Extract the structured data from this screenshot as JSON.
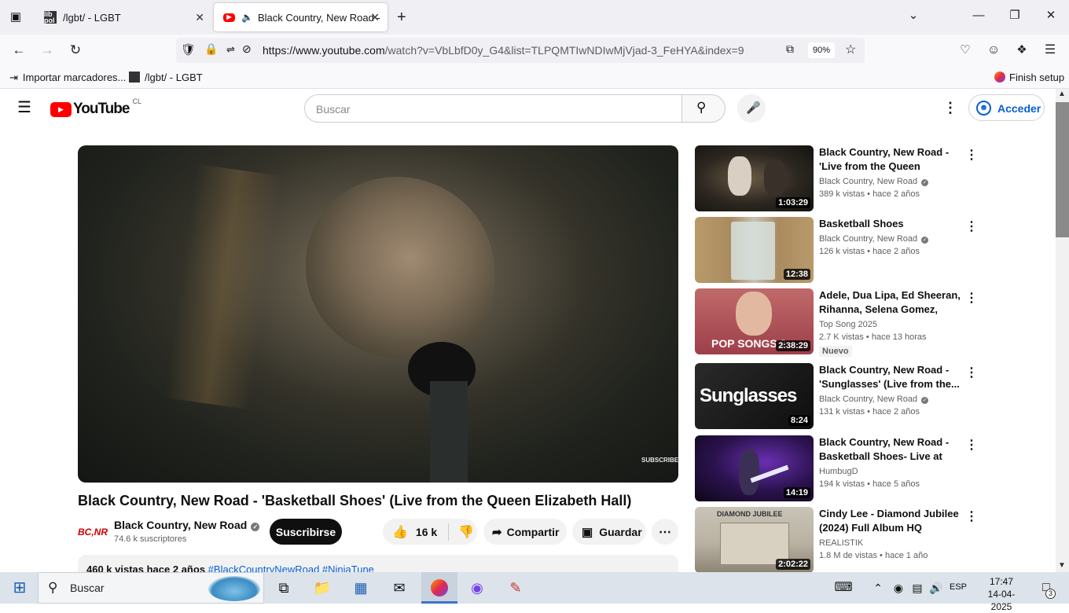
{
  "browser": {
    "tabs": [
      {
        "label": "/lgbt/ - LGBT",
        "favicon_text": "lib pol"
      },
      {
        "label": "Black Country, New Road -",
        "active": true
      }
    ],
    "url_host": "https://www.youtube.com",
    "url_path": "/watch?v=VbLbfD0y_G4&list=TLPQMTIwNDIwMjVjad-3_FeHYA&index=9",
    "zoom": "90%",
    "bookmarks": [
      {
        "label": "Importar marcadores..."
      },
      {
        "label": "/lgbt/ - LGBT"
      }
    ],
    "finish_setup": "Finish setup"
  },
  "youtube": {
    "logo_text": "YouTube",
    "country_code": "CL",
    "search_placeholder": "Buscar",
    "signin_label": "Acceder",
    "player_overlay": "SUBSCRIBE",
    "video": {
      "title": "Black Country, New Road - 'Basketball Shoes' (Live from the Queen Elizabeth Hall)",
      "channel": "Black Country, New Road",
      "channel_logo_text": "BC,NR",
      "subscribers": "74.6 k suscriptores",
      "subscribe_label": "Suscribirse",
      "likes": "16 k",
      "share_label": "Compartir",
      "save_label": "Guardar",
      "desc_stats": "460 k vistas  hace 2 años",
      "desc_tags": "#BlackCountryNewRoad #NinjaTune"
    },
    "recommendations": [
      {
        "title": "Black Country, New Road - 'Live from the Queen Elizabeth Hall'",
        "channel": "Black Country, New Road",
        "verified": true,
        "views": "389 k vistas",
        "age": "hace 2 años",
        "duration": "1:03:29"
      },
      {
        "title": "Basketball Shoes",
        "channel": "Black Country, New Road",
        "verified": true,
        "views": "126 k vistas",
        "age": "hace 2 años",
        "duration": "12:38"
      },
      {
        "title": "Adele, Dua Lipa, Ed Sheeran, Rihanna, Selena Gomez, Bruno...",
        "channel": "Top Song 2025",
        "verified": false,
        "views": "2.7 K vistas",
        "age": "hace 13 horas",
        "duration": "2:38:29",
        "badge": "Nuevo",
        "thumb_text": "POP SONGS 2"
      },
      {
        "title": "Black Country, New Road - 'Sunglasses' (Live from the...",
        "channel": "Black Country, New Road",
        "verified": true,
        "views": "131 k vistas",
        "age": "hace 2 años",
        "duration": "8:24",
        "thumb_text": "Sunglasses"
      },
      {
        "title": "Black Country, New Road - Basketball Shoes- Live at YES...",
        "channel": "HumbugD",
        "verified": false,
        "views": "194 k vistas",
        "age": "hace 5 años",
        "duration": "14:19"
      },
      {
        "title": "Cindy Lee - Diamond Jubilee (2024) Full Album HQ",
        "channel": "REALISTIK",
        "verified": false,
        "views": "1.8 M de vistas",
        "age": "hace 1 año",
        "duration": "2:02:22",
        "thumb_text": "DIAMOND JUBILEE"
      }
    ]
  },
  "taskbar": {
    "search_placeholder": "Buscar",
    "language": "ESP",
    "time": "17:47",
    "date": "14-04-2025",
    "notification_count": "3"
  }
}
